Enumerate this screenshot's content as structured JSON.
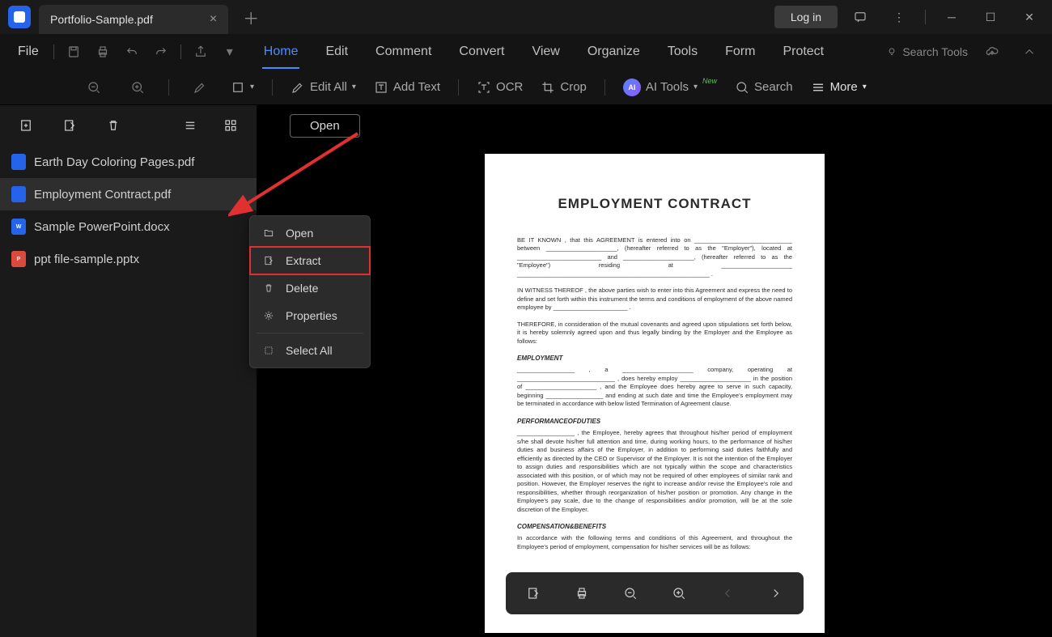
{
  "titlebar": {
    "tab_title": "Portfolio-Sample.pdf",
    "login": "Log in"
  },
  "menubar": {
    "file": "File",
    "tabs": [
      "Home",
      "Edit",
      "Comment",
      "Convert",
      "View",
      "Organize",
      "Tools",
      "Form",
      "Protect"
    ],
    "active_tab": 0,
    "search_tools": "Search Tools"
  },
  "toolbar": {
    "edit_all": "Edit All",
    "add_text": "Add Text",
    "ocr": "OCR",
    "crop": "Crop",
    "ai_tools": "AI Tools",
    "new_badge": "New",
    "search": "Search",
    "more": "More"
  },
  "viewer": {
    "open": "Open"
  },
  "sidebar": {
    "files": [
      {
        "name": "Earth Day Coloring Pages.pdf",
        "type": "pdf"
      },
      {
        "name": "Employment Contract.pdf",
        "type": "pdf",
        "selected": true
      },
      {
        "name": "Sample PowerPoint.docx",
        "type": "doc"
      },
      {
        "name": "ppt file-sample.pptx",
        "type": "ppt"
      }
    ]
  },
  "context_menu": {
    "open": "Open",
    "extract": "Extract",
    "delete": "Delete",
    "properties": "Properties",
    "select_all": "Select All"
  },
  "document": {
    "title": "EMPLOYMENT CONTRACT",
    "p1": "BE IT KNOWN , that this AGREEMENT is entered into on _____________________________ between _____________________, (hereafter referred to as the \"Employer\"), located at _________________________ and _____________________, (hereafter referred to as the \"Employee\") residing at _____________________ _________________________________________________________ .",
    "p2": "IN WITNESS THEREOF , the above parties wish to enter into this Agreement and express the need to define and set forth within this instrument the terms and conditions of employment of the above named employee by ______________________ .",
    "p3": "THEREFORE, in consideration of the mutual covenants and agreed upon stipulations set forth below, it is hereby solemnly agreed upon and thus legally binding by the Employer and the Employee as follows:",
    "h1": "EMPLOYMENT",
    "p4": "_________________ , a _____________________ company, operating at _____________________________ , does hereby employ _____________________ in the position of _____________________ , and the Employee does hereby agree to serve in such capacity, beginning _________________ and ending at such date and time the Employee's employment may be terminated in accordance with below listed Termination of Agreement clause.",
    "h2": "PERFORMANCEOFDUTIES",
    "p5": "_________________ , the Employee, hereby agrees that throughout his/her period of employment s/he shall devote his/her full attention and time, during working hours, to the performance of his/her duties and business affairs of the Employer, in addition to performing said duties faithfully and efficiently as directed by the CEO or Supervisor of the Employer. It is not the intention of the Employer to assign duties and responsibilities which are not typically within the scope and characteristics associated with this position, or of which may not be required of other employees of similar rank and position. However, the Employer reserves the right to increase and/or revise the Employee's role and responsibilities, whether through reorganization of his/her position or promotion. Any change in the Employee's pay scale, due to the change of responsibilities and/or promotion, will be at the sole discretion of the Employer.",
    "h3": "COMPENSATION&BENEFITS",
    "p6": "In accordance with the following terms and conditions of this Agreement, and throughout the Employee's period of employment, compensation for his/her services will be as follows:"
  }
}
